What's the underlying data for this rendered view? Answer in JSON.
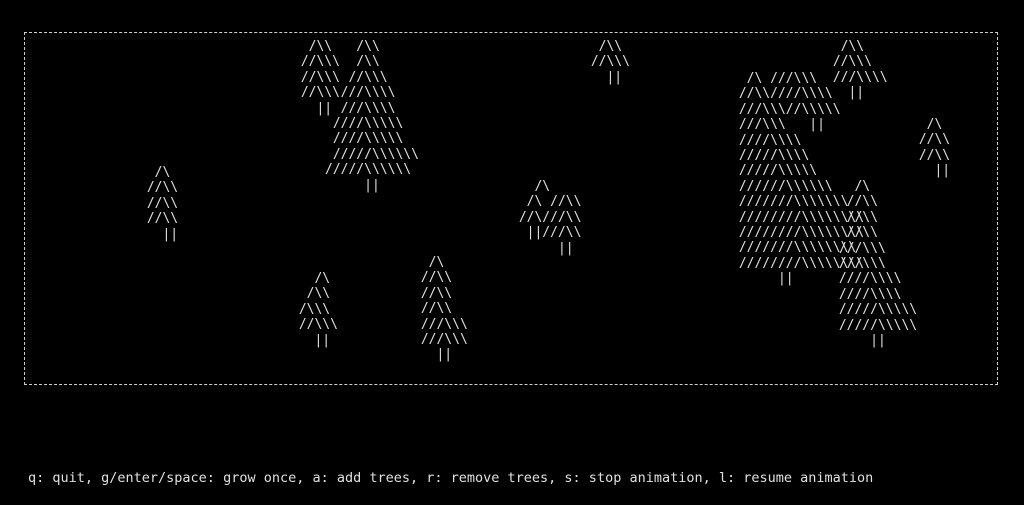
{
  "colors": {
    "background": "#000000",
    "foreground": "#e0e0e0",
    "frame": "#cfcfcf"
  },
  "trees": [
    {
      "id": "t1",
      "art": "  /\\\\\n //\\\\\\\n //\\\\\\\n //\\\\\\\n   ||"
    },
    {
      "id": "t2",
      "art": "    /\\\\\n    /\\\\\n   //\\\\\\\n  ///\\\\\\\\\n  ///\\\\\\\\\n ////\\\\\\\\\\\n ////\\\\\\\\\\\n /////\\\\\\\\\\\\\n/////\\\\\\\\\\\\\n     ||"
    },
    {
      "id": "t3",
      "art": "  /\\\\\n //\\\\\\\n   ||"
    },
    {
      "id": "t4",
      "art": "  /\\\n //\\\\\n //\\\\\n //\\\\\n   ||"
    },
    {
      "id": "t5",
      "art": "   /\\\n  /\\\\\n /\\\\\\\n //\\\\\\\n   ||"
    },
    {
      "id": "t6",
      "art": "  /\\\n //\\\\\n //\\\\\n //\\\\\n ///\\\\\\\n ///\\\\\\\n   ||"
    },
    {
      "id": "t7",
      "art": "   /\\\n  /\\ //\\\\\n //\\///\\\\\n  ||///\\\\\n      ||"
    },
    {
      "id": "t8",
      "art": "  /\\\\\n //\\\\\\\n ///\\\\\\\\\n   ||"
    },
    {
      "id": "t9",
      "art": "  /\\ ///\\\\\\\n //\\\\////\\\\\\\\\n ///\\\\\\//\\\\\\\\\\\n ///\\\\\\   ||\n ////\\\\\\\\\n /////\\\\\\\\\n /////\\\\\\\\\\\n //////\\\\\\\\\\\\\n ///////\\\\\\\\\\\\\\\n ////////\\\\\\\\\\\\\\\\\n ////////\\\\\\\\\\\\\\\\\n ///////\\\\\\\\\\\\\\\\\n ////////\\\\\\\\\\\\\\\\\n      ||"
    },
    {
      "id": "t10",
      "art": "   /\\\n  //\\\\\n  //\\\\\n  //\\\\\n ///\\\\\\\n ///\\\\\\\n ////\\\\\\\\\n ////\\\\\\\\\n /////\\\\\\\\\\\n /////\\\\\\\\\\\n     ||"
    },
    {
      "id": "t11",
      "art": "  /\\\n //\\\\\n //\\\\\n   ||"
    }
  ],
  "help": {
    "text": "q: quit, g/enter/space: grow once, a: add trees, r: remove trees, s: stop animation, l: resume animation"
  }
}
